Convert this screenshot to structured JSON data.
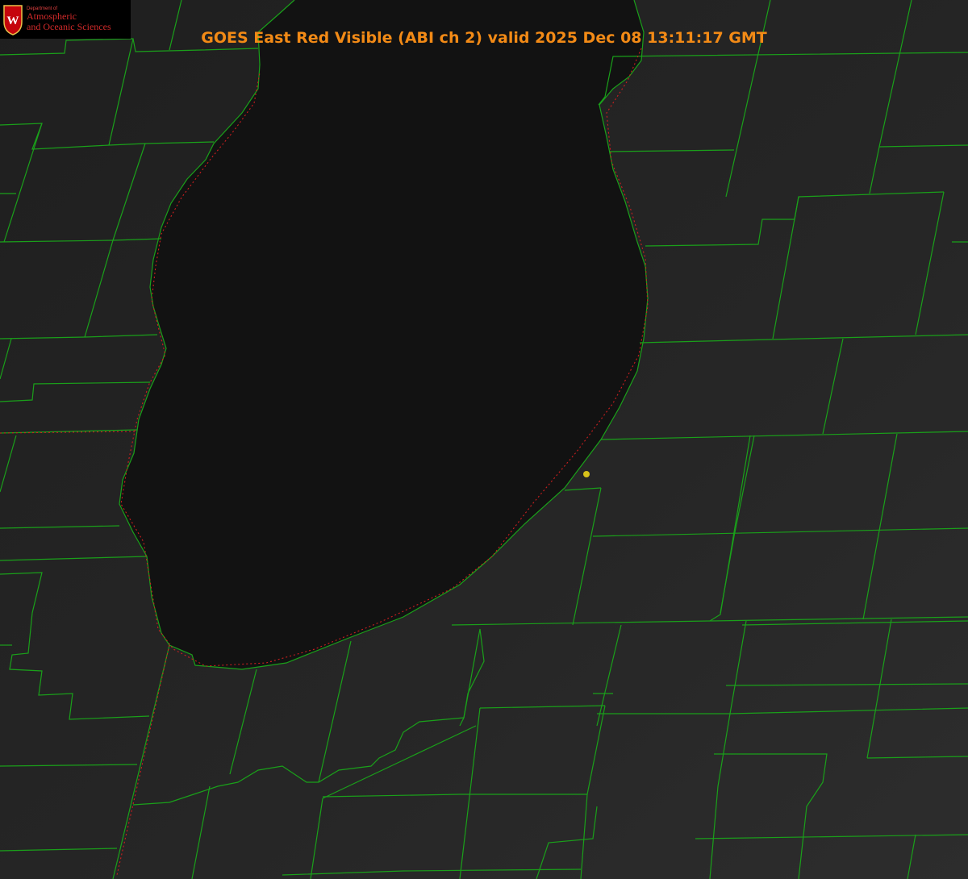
{
  "title": "GOES East Red Visible (ABI ch 2) valid 2025 Dec 08 13:11:17 GMT",
  "logo": {
    "crest_letter": "W",
    "dept": "Department of",
    "line1": "Atmospheric",
    "line2": "and Oceanic Sciences"
  },
  "colors": {
    "boundary": "#1aa01a",
    "shoreline": "#cc1f1f",
    "marker": "#d8c21a",
    "title": "#f28a16",
    "logo_text": "#d32a2a"
  }
}
